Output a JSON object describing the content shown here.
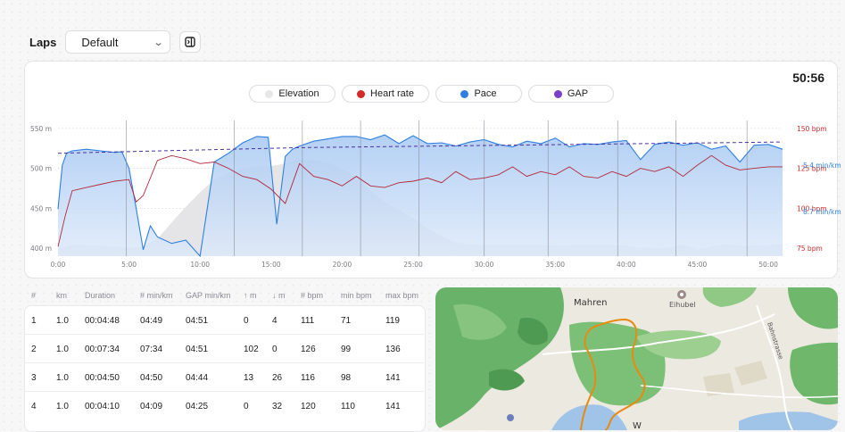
{
  "laps": {
    "title": "Laps",
    "selected": "Default"
  },
  "chart_data": {
    "type": "area",
    "total_time": "50:56",
    "legend": [
      {
        "label": "Elevation",
        "color": "#e8e8ea"
      },
      {
        "label": "Heart rate",
        "color": "#d42a2a"
      },
      {
        "label": "Pace",
        "color": "#2f7fe0"
      },
      {
        "label": "GAP",
        "color": "#7a3fc8"
      }
    ],
    "x_ticks": [
      "0:00",
      "5:00",
      "10:00",
      "15:00",
      "20:00",
      "25:00",
      "30:00",
      "35:00",
      "40:00",
      "45:00",
      "50:00"
    ],
    "x_range_min": [
      0,
      51
    ],
    "left_axis": {
      "ticks": [
        "550 m",
        "500 m",
        "450 m",
        "400 m"
      ],
      "values": [
        550,
        500,
        450,
        400
      ],
      "range": [
        390,
        560
      ]
    },
    "right_axis_hr": {
      "ticks": [
        "150 bpm",
        "125 bpm",
        "100 bpm",
        "75 bpm"
      ],
      "values": [
        150,
        125,
        100,
        75
      ],
      "range": [
        70,
        155
      ]
    },
    "right_axis_pace": {
      "ticks": [
        "5.4 min/km",
        "8.7 min/km"
      ]
    },
    "lap_markers_min": [
      4.8,
      12.4,
      17.2,
      21.3,
      25.4,
      30.0,
      34.5,
      39.4,
      43.5,
      48.5
    ],
    "elevation": {
      "t": [
        0,
        1,
        2,
        3,
        4,
        5,
        6,
        7,
        8,
        9,
        10,
        11,
        12,
        13,
        14,
        15,
        16,
        17,
        18,
        19,
        20,
        21,
        22,
        23,
        24,
        25,
        26,
        27,
        28,
        29,
        30,
        31,
        32,
        33,
        34,
        35,
        36,
        37,
        38,
        39,
        40,
        41,
        42,
        43,
        44,
        45,
        46,
        47,
        48,
        49,
        50,
        51
      ],
      "v": [
        400,
        404,
        404,
        403,
        402,
        400,
        402,
        412,
        432,
        452,
        470,
        486,
        494,
        500,
        502,
        503,
        506,
        511,
        510,
        507,
        500,
        490,
        472,
        458,
        448,
        438,
        425,
        415,
        407,
        405,
        404,
        404,
        404,
        404,
        404,
        403,
        404,
        404,
        404,
        404,
        403,
        401,
        400,
        400,
        405,
        398,
        402,
        405,
        403,
        403,
        404,
        405
      ]
    },
    "heart_rate": {
      "t": [
        0,
        0.5,
        1,
        2,
        3,
        4,
        5,
        5.5,
        6,
        7,
        8,
        9,
        10,
        11,
        12,
        13,
        14,
        15,
        16,
        17,
        18,
        19,
        20,
        21,
        22,
        23,
        24,
        25,
        26,
        27,
        28,
        29,
        30,
        31,
        32,
        33,
        34,
        35,
        36,
        37,
        38,
        39,
        40,
        41,
        42,
        43,
        44,
        45,
        46,
        47,
        48,
        49,
        50,
        51
      ],
      "v": [
        76,
        95,
        111,
        113,
        115,
        117,
        118,
        104,
        108,
        130,
        133,
        131,
        128,
        129,
        125,
        120,
        118,
        112,
        103,
        128,
        120,
        118,
        114,
        120,
        114,
        113,
        116,
        117,
        119,
        116,
        123,
        118,
        119,
        121,
        126,
        120,
        123,
        121,
        126,
        120,
        119,
        123,
        120,
        125,
        123,
        126,
        120,
        127,
        133,
        127,
        124,
        125,
        126,
        126
      ]
    },
    "pace": {
      "t": [
        0,
        0.3,
        0.6,
        1,
        2,
        3,
        4,
        4.5,
        5,
        5.5,
        6,
        6.5,
        7,
        8,
        9,
        10,
        11,
        12,
        13,
        14,
        14.8,
        15.4,
        16,
        16.5,
        17,
        18,
        19,
        20,
        21,
        22,
        23,
        24,
        25,
        26,
        27,
        28,
        29,
        30,
        31,
        32,
        33,
        34,
        35,
        36,
        37,
        38,
        39,
        40,
        41,
        42,
        43,
        44,
        45,
        46,
        47,
        48,
        49,
        50,
        51
      ],
      "v": [
        449,
        504,
        519,
        522,
        524,
        522,
        520,
        521,
        500,
        450,
        398,
        428,
        414,
        406,
        410,
        390,
        508,
        519,
        532,
        540,
        539,
        430,
        515,
        524,
        528,
        534,
        537,
        540,
        540,
        536,
        542,
        531,
        541,
        531,
        532,
        528,
        533,
        536,
        530,
        527,
        534,
        531,
        538,
        527,
        531,
        530,
        533,
        535,
        511,
        530,
        533,
        529,
        532,
        524,
        528,
        508,
        529,
        530,
        524,
        519
      ]
    },
    "gap": {
      "t": [
        0,
        17,
        51
      ],
      "v": [
        519,
        526,
        533
      ]
    }
  },
  "table": {
    "headers": [
      "#",
      "km",
      "Duration",
      "# min/km",
      "GAP min/km",
      "↑ m",
      "↓ m",
      "# bpm",
      "min bpm",
      "max bpm"
    ],
    "rows": [
      [
        "1",
        "1.0",
        "00:04:48",
        "04:49",
        "04:51",
        "0",
        "4",
        "111",
        "71",
        "119"
      ],
      [
        "2",
        "1.0",
        "00:07:34",
        "07:34",
        "04:51",
        "102",
        "0",
        "126",
        "99",
        "136"
      ],
      [
        "3",
        "1.0",
        "00:04:50",
        "04:50",
        "04:44",
        "13",
        "26",
        "116",
        "98",
        "141"
      ],
      [
        "4",
        "1.0",
        "00:04:10",
        "04:09",
        "04:25",
        "0",
        "32",
        "120",
        "110",
        "141"
      ]
    ]
  },
  "map": {
    "labels": {
      "mahren": "Mahren",
      "eihubel": "Eihubel",
      "street": "Bahnstrasse",
      "w": "W"
    },
    "colors": {
      "forest": "#69b26a",
      "route": "#e88a12",
      "water": "#9fc4e8"
    }
  }
}
